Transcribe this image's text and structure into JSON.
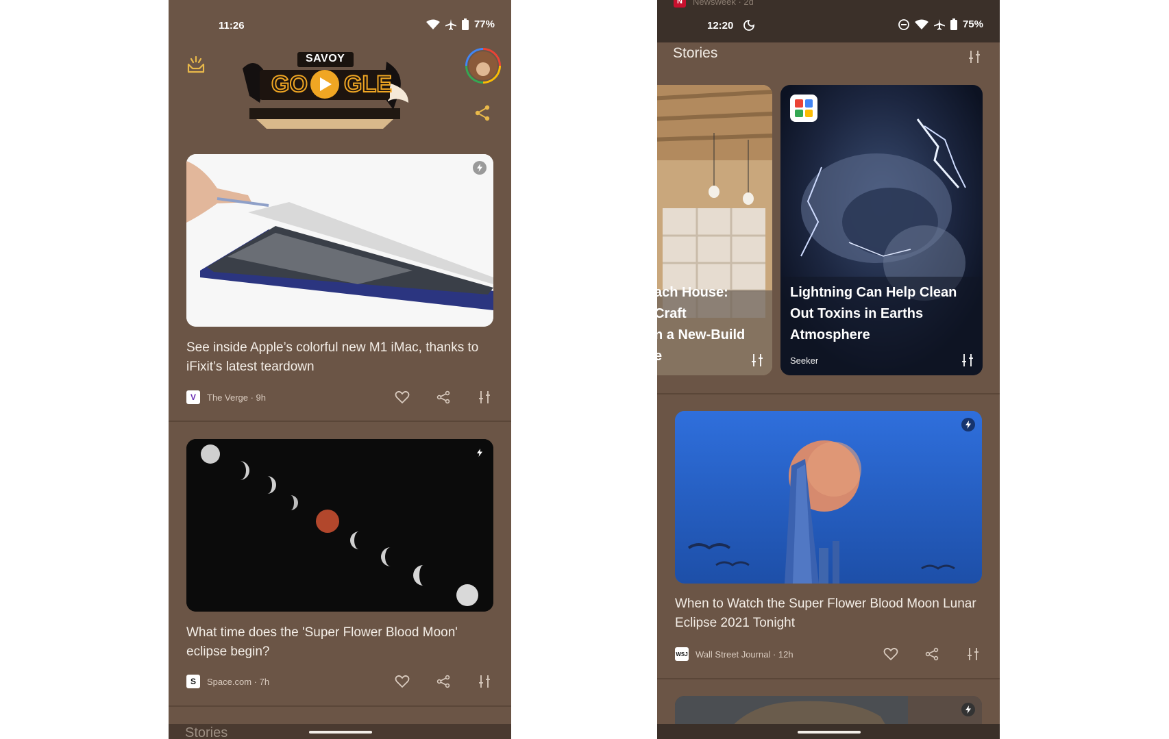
{
  "left_phone": {
    "status": {
      "time": "11:26",
      "battery": "77%"
    },
    "doodle": {
      "badge": "SAVOY",
      "word_left": "GO",
      "word_right": "GLE"
    },
    "articles": [
      {
        "headline": "See inside Apple’s colorful new M1 iMac, thanks to iFixit’s latest teardown",
        "source": "The Verge · 9h",
        "logo": "V"
      },
      {
        "headline": "What time does the 'Super Flower Blood Moon' eclipse begin?",
        "source": "Space.com · 7h",
        "logo": "S"
      }
    ],
    "bottom_section": "Stories"
  },
  "right_phone": {
    "status": {
      "time": "12:20",
      "battery": "75%"
    },
    "top_peek_source": "Newsweek · 2d",
    "section_title": "Stories",
    "stories": [
      {
        "title_lines": [
          "ach House: Craft",
          "n a New-Build",
          "e"
        ]
      },
      {
        "title": "Lightning Can Help Clean Out Toxins in Earths Atmosphere",
        "source": "Seeker"
      }
    ],
    "articles": [
      {
        "headline": "When to Watch the Super Flower Blood Moon Lunar Eclipse 2021 Tonight",
        "source": "Wall Street Journal · 12h",
        "logo": "WSJ"
      }
    ]
  },
  "colors": {
    "background": "#6b5546",
    "divider": "#5a4638",
    "text": "#f4eee7"
  }
}
